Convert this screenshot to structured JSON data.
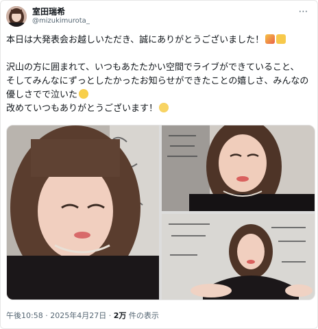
{
  "tweet": {
    "display_name": "室田瑞希",
    "handle": "@mizukimurota_",
    "more_icon": "⋯",
    "lines": [
      "本日は大発表会お越しいただき、誠にありがとうございました！",
      "",
      "沢山の方に囲まれて、いつもあたたかい空間でライブができていること、",
      "そしてみんなにずっとしたかったお知らせができたことの嬉しさ、みんなの",
      "優しさでで泣いた",
      "改めていつもありがとうございます！"
    ],
    "emojis": [
      "party-popper",
      "handshake",
      "crying-face",
      "pleading-face"
    ],
    "time": "午後10:58",
    "separator": " · ",
    "date": "2025年4月27日",
    "views_count": "2万",
    "views_label": " 件の表示"
  },
  "colors": {
    "text": "#0f1419",
    "secondary": "#536471",
    "border": "#e6e6e6"
  }
}
